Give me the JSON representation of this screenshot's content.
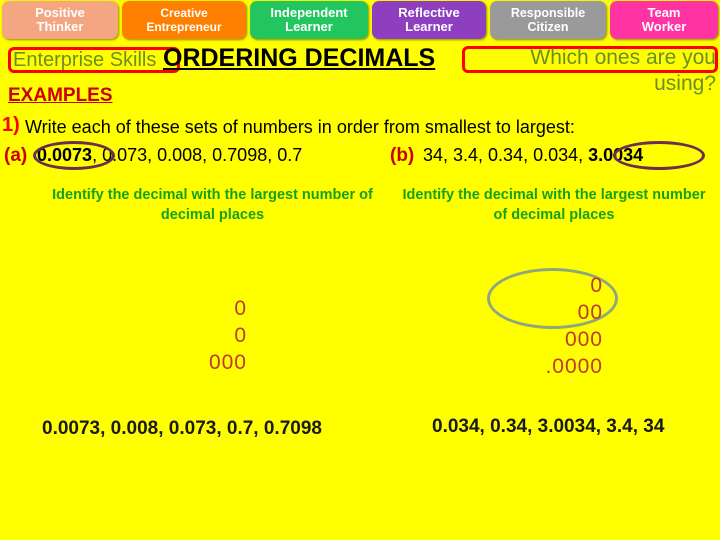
{
  "skill_tabs": [
    {
      "line1": "Positive",
      "line2": "Thinker",
      "color": "#F4A582"
    },
    {
      "line1": "Creative",
      "line2": "Entrepreneur",
      "color": "#FF8000"
    },
    {
      "line1": "Independent",
      "line2": "Learner",
      "color": "#22C55E"
    },
    {
      "line1": "Reflective",
      "line2": "Learner",
      "color": "#8E3FC0"
    },
    {
      "line1": "Responsible",
      "line2": "Citizen",
      "color": "#9A9A9A"
    },
    {
      "line1": "Team",
      "line2": "Worker",
      "color": "#FF33A1"
    }
  ],
  "header": {
    "enterprise_skills": "Enterprise Skills",
    "title": "ORDERING DECIMALS",
    "which_ones": "Which ones are you using?",
    "examples": "EXAMPLES"
  },
  "question": {
    "number": "1)",
    "text": "Write each of these sets of numbers in order from smallest to largest:"
  },
  "part_a": {
    "label": "(a)",
    "circled": "0.0073",
    "rest": ", 0.073, 0.008, 0.7098, 0.7",
    "hint": "Identify the decimal with the largest number of decimal places",
    "zeros": [
      "0",
      "0",
      "000"
    ],
    "answer": "0.0073, 0.008, 0.073, 0.7, 0.7098"
  },
  "part_b": {
    "label": "(b)",
    "lead": "34, 3.4, 0.34, 0.034, ",
    "circled": "3.0034",
    "hint": "Identify the decimal with the largest number of decimal places",
    "zeros": [
      "0",
      "00",
      "000",
      ".0000"
    ],
    "answer": "0.034, 0.34, 3.0034, 3.4, 34"
  },
  "colors": {
    "background": "#FFFF00",
    "accent_red": "#FF0000",
    "hint_green": "#17A01A",
    "label_olive": "#6B8E23",
    "zero_red": "#C0392B",
    "circle_maroon": "#6B2E4E",
    "oval_sage": "#8FA87A"
  }
}
